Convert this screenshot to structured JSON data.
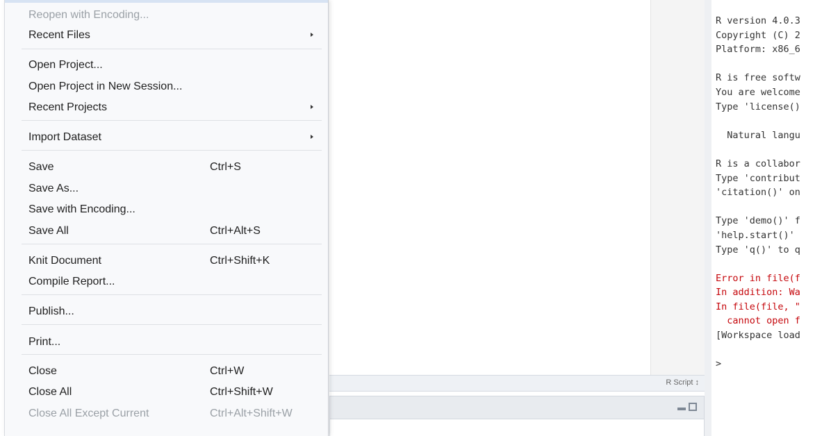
{
  "menu": {
    "items": [
      {
        "label": "Reopen with Encoding...",
        "disabled": true
      },
      {
        "label": "Recent Files",
        "submenu": true
      },
      {
        "label": "Open Project..."
      },
      {
        "label": "Open Project in New Session..."
      },
      {
        "label": "Recent Projects",
        "submenu": true
      },
      {
        "label": "Import Dataset",
        "submenu": true
      },
      {
        "label": "Save",
        "shortcut": "Ctrl+S"
      },
      {
        "label": "Save As..."
      },
      {
        "label": "Save with Encoding..."
      },
      {
        "label": "Save All",
        "shortcut": "Ctrl+Alt+S"
      },
      {
        "label": "Knit Document",
        "shortcut": "Ctrl+Shift+K"
      },
      {
        "label": "Compile Report..."
      },
      {
        "label": "Publish..."
      },
      {
        "label": "Print..."
      },
      {
        "label": "Close",
        "shortcut": "Ctrl+W"
      },
      {
        "label": "Close All",
        "shortcut": "Ctrl+Shift+W"
      },
      {
        "label": "Close All Except Current",
        "shortcut": "Ctrl+Alt+Shift+W",
        "disabled": true
      }
    ]
  },
  "editor": {
    "script_type": "R Script ↕"
  },
  "console": {
    "lines": [
      {
        "text": "R version 4.0.3",
        "kind": "normal"
      },
      {
        "text": "Copyright (C) 2",
        "kind": "normal"
      },
      {
        "text": "Platform: x86_6",
        "kind": "normal"
      },
      {
        "text": "",
        "kind": "gap"
      },
      {
        "text": "R is free softw",
        "kind": "normal"
      },
      {
        "text": "You are welcome",
        "kind": "normal"
      },
      {
        "text": "Type 'license()",
        "kind": "normal"
      },
      {
        "text": "",
        "kind": "gap"
      },
      {
        "text": "  Natural langu",
        "kind": "normal"
      },
      {
        "text": "",
        "kind": "gap"
      },
      {
        "text": "R is a collabor",
        "kind": "normal"
      },
      {
        "text": "Type 'contribut",
        "kind": "normal"
      },
      {
        "text": "'citation()' on",
        "kind": "normal"
      },
      {
        "text": "",
        "kind": "gap"
      },
      {
        "text": "Type 'demo()' f",
        "kind": "normal"
      },
      {
        "text": "'help.start()'",
        "kind": "normal"
      },
      {
        "text": "Type 'q()' to q",
        "kind": "normal"
      },
      {
        "text": "",
        "kind": "gap"
      },
      {
        "text": "Error in file(f",
        "kind": "err"
      },
      {
        "text": "In addition: Wa",
        "kind": "err"
      },
      {
        "text": "In file(file, \"",
        "kind": "err"
      },
      {
        "text": "  cannot open f",
        "kind": "err"
      },
      {
        "text": "[Workspace load",
        "kind": "normal"
      },
      {
        "text": "",
        "kind": "gap"
      },
      {
        "text": ">",
        "kind": "normal"
      }
    ]
  }
}
